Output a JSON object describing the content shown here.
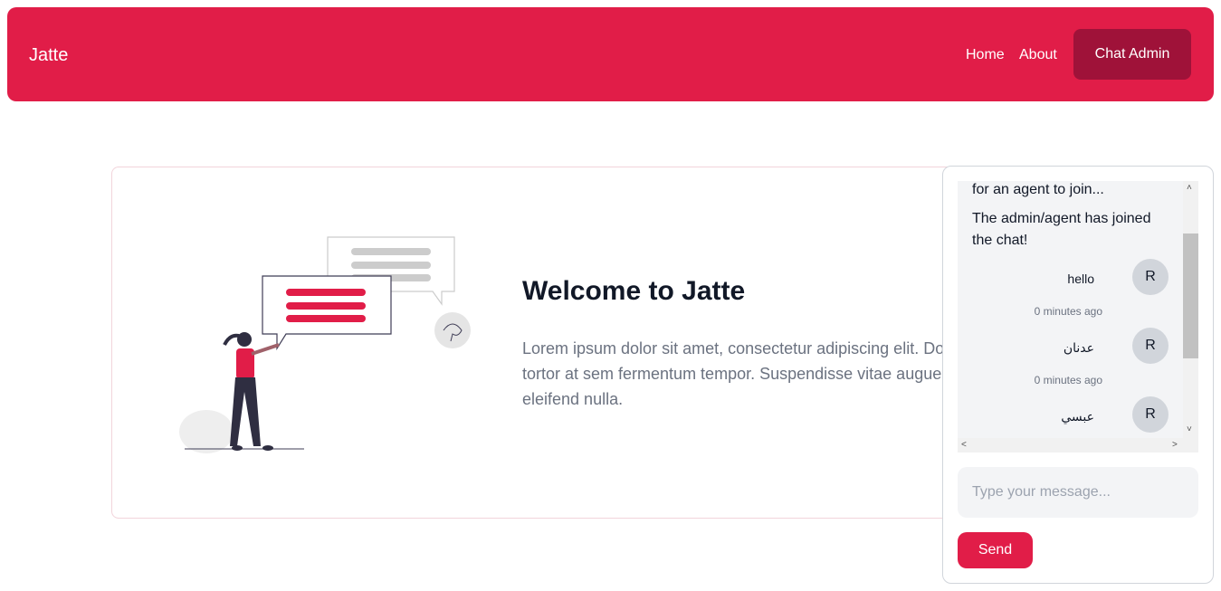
{
  "navbar": {
    "brand": "Jatte",
    "links": [
      "Home",
      "About"
    ],
    "chat_admin_label": "Chat Admin",
    "color": "#e11d48",
    "button_color": "#9f1239"
  },
  "welcome": {
    "title": "Welcome to Jatte",
    "text_lines": [
      "Lorem ipsum dolor sit amet, consectetur adipiscing elit. Do",
      "tortor at sem fermentum tempor. Suspendisse vitae augue",
      "eleifend nulla."
    ]
  },
  "chat": {
    "system_messages": [
      "for an agent to join...",
      "The admin/agent has joined the chat!"
    ],
    "messages": [
      {
        "text": "hello",
        "avatar": "R",
        "time": "0 minutes ago"
      },
      {
        "text": "عدنان",
        "avatar": "R",
        "time": "0 minutes ago"
      },
      {
        "text": "عبسي",
        "avatar": "R"
      }
    ],
    "input_placeholder": "Type your message...",
    "send_label": "Send"
  },
  "icons": {
    "scroll_up": "chevron-up-icon",
    "scroll_down": "chevron-down-icon",
    "scroll_left": "chevron-left-icon",
    "scroll_right": "chevron-right-icon"
  }
}
